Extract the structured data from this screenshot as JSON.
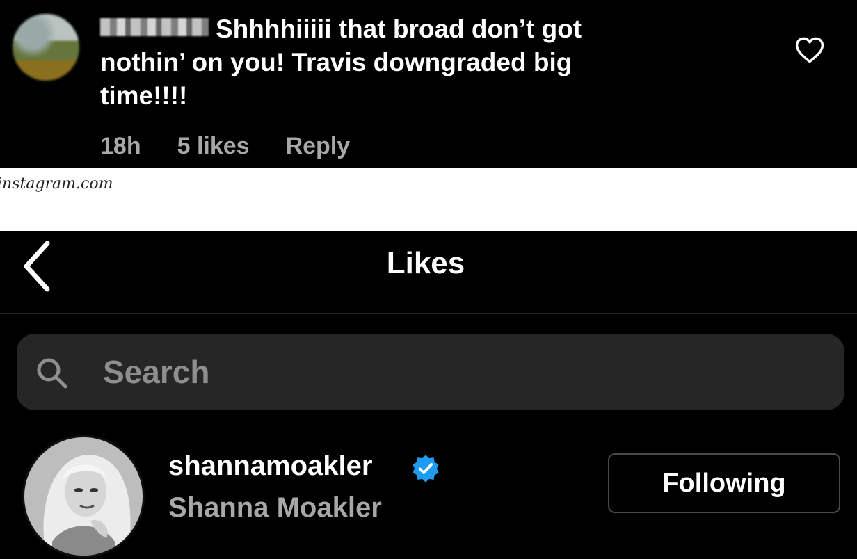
{
  "comment": {
    "text": "Shhhhiiiii that broad don’t got nothin’ on you! Travis downgraded big time!!!!",
    "time": "18h",
    "likes": "5 likes",
    "reply_label": "Reply"
  },
  "caption": {
    "source": "instagram.com"
  },
  "likes_screen": {
    "title": "Likes",
    "search": {
      "placeholder": "Search"
    },
    "users": [
      {
        "username": "shannamoakler",
        "full_name": "Shanna Moakler",
        "verified": true,
        "button_label": "Following"
      }
    ]
  },
  "colors": {
    "background": "#000000",
    "secondary_text": "#a8a8a8",
    "search_bg": "#262626",
    "verified": "#1d9bf0"
  },
  "icons": {
    "heart": "heart-outline-icon",
    "back": "chevron-left-icon",
    "search": "search-icon",
    "verified": "verified-badge-icon"
  }
}
